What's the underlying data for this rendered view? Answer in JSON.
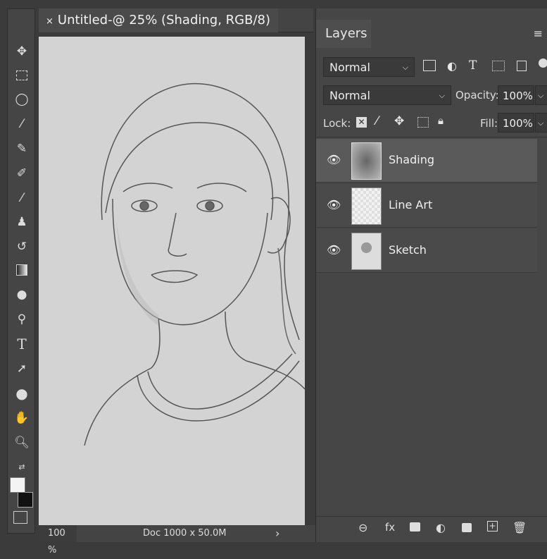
{
  "document_tab": {
    "close": "×",
    "title": "Untitled-@ 25%  (Shading, RGB/8)"
  },
  "toolbar": {
    "tools": [
      "move-icon",
      "marquee-icon",
      "lasso-icon",
      "quick-select-icon",
      "healing-icon",
      "brush-selection-icon",
      "brush-icon",
      "stamp-icon",
      "history-brush-icon",
      "gradient-icon",
      "burn-icon",
      "dodge-icon",
      "type-icon",
      "path-select-icon",
      "ellipse-icon",
      "hand-icon",
      "zoom-icon"
    ],
    "type_glyph": "T"
  },
  "status": {
    "zoom": "100 %",
    "doc": "Doc  1000 x 50.0M",
    "arrow": "›"
  },
  "layers_panel": {
    "tab": "Layers",
    "menu": "≡",
    "filter_mode": "Normal",
    "blend_mode": "Normal",
    "opacity_label": "Opacity:",
    "opacity_value": "100%",
    "lock_label": "Lock:",
    "fill_label": "Fill:",
    "fill_value": "100%",
    "layers": [
      {
        "name": "Shading",
        "selected": true,
        "visible": true
      },
      {
        "name": "Line Art",
        "selected": false,
        "visible": true
      },
      {
        "name": "Sketch",
        "selected": false,
        "visible": true
      }
    ],
    "bottom_icons": [
      "link-icon",
      "fx-icon",
      "mask-icon",
      "adjustment-icon",
      "group-folder-icon",
      "new-layer-icon",
      "trash-icon"
    ],
    "fx_label": "fx"
  }
}
